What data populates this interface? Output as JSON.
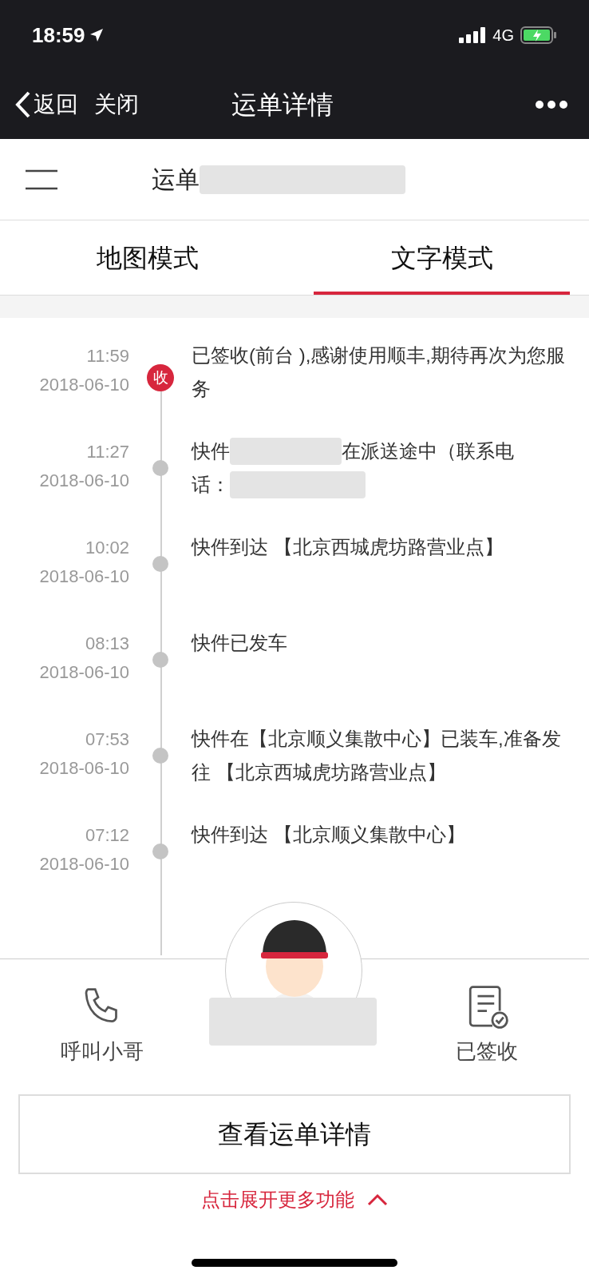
{
  "status_bar": {
    "time": "18:59",
    "network": "4G"
  },
  "nav": {
    "back": "返回",
    "close": "关闭",
    "title": "运单详情"
  },
  "waybill": {
    "label": "运单"
  },
  "tabs": [
    {
      "label": "地图模式",
      "selected": false
    },
    {
      "label": "文字模式",
      "selected": true
    }
  ],
  "events": [
    {
      "time": "11:59",
      "date": "2018-06-10",
      "kind": "signed",
      "badge": "收",
      "parts": [
        "已签收(前台 ),感谢使用顺丰,期待再次为您服务"
      ]
    },
    {
      "time": "11:27",
      "date": "2018-06-10",
      "kind": "transit",
      "lines": [
        [
          "快件",
          "在派送途中（联系电"
        ],
        [
          "话："
        ]
      ]
    },
    {
      "time": "10:02",
      "date": "2018-06-10",
      "kind": "transit",
      "parts": [
        "快件到达 【北京西城虎坊路营业点】"
      ]
    },
    {
      "time": "08:13",
      "date": "2018-06-10",
      "kind": "transit",
      "parts": [
        "快件已发车"
      ]
    },
    {
      "time": "07:53",
      "date": "2018-06-10",
      "kind": "transit",
      "parts": [
        "快件在【北京顺义集散中心】已装车,准备发往 【北京西城虎坊路营业点】"
      ]
    },
    {
      "time": "07:12",
      "date": "2018-06-10",
      "kind": "transit",
      "parts": [
        "快件到达 【北京顺义集散中心】"
      ]
    }
  ],
  "actions": [
    {
      "label": "呼叫小哥",
      "kind": "call"
    },
    {
      "label": "已签收",
      "kind": "signed"
    }
  ],
  "detail_button": "查看运单详情",
  "expand_link": "点击展开更多功能"
}
